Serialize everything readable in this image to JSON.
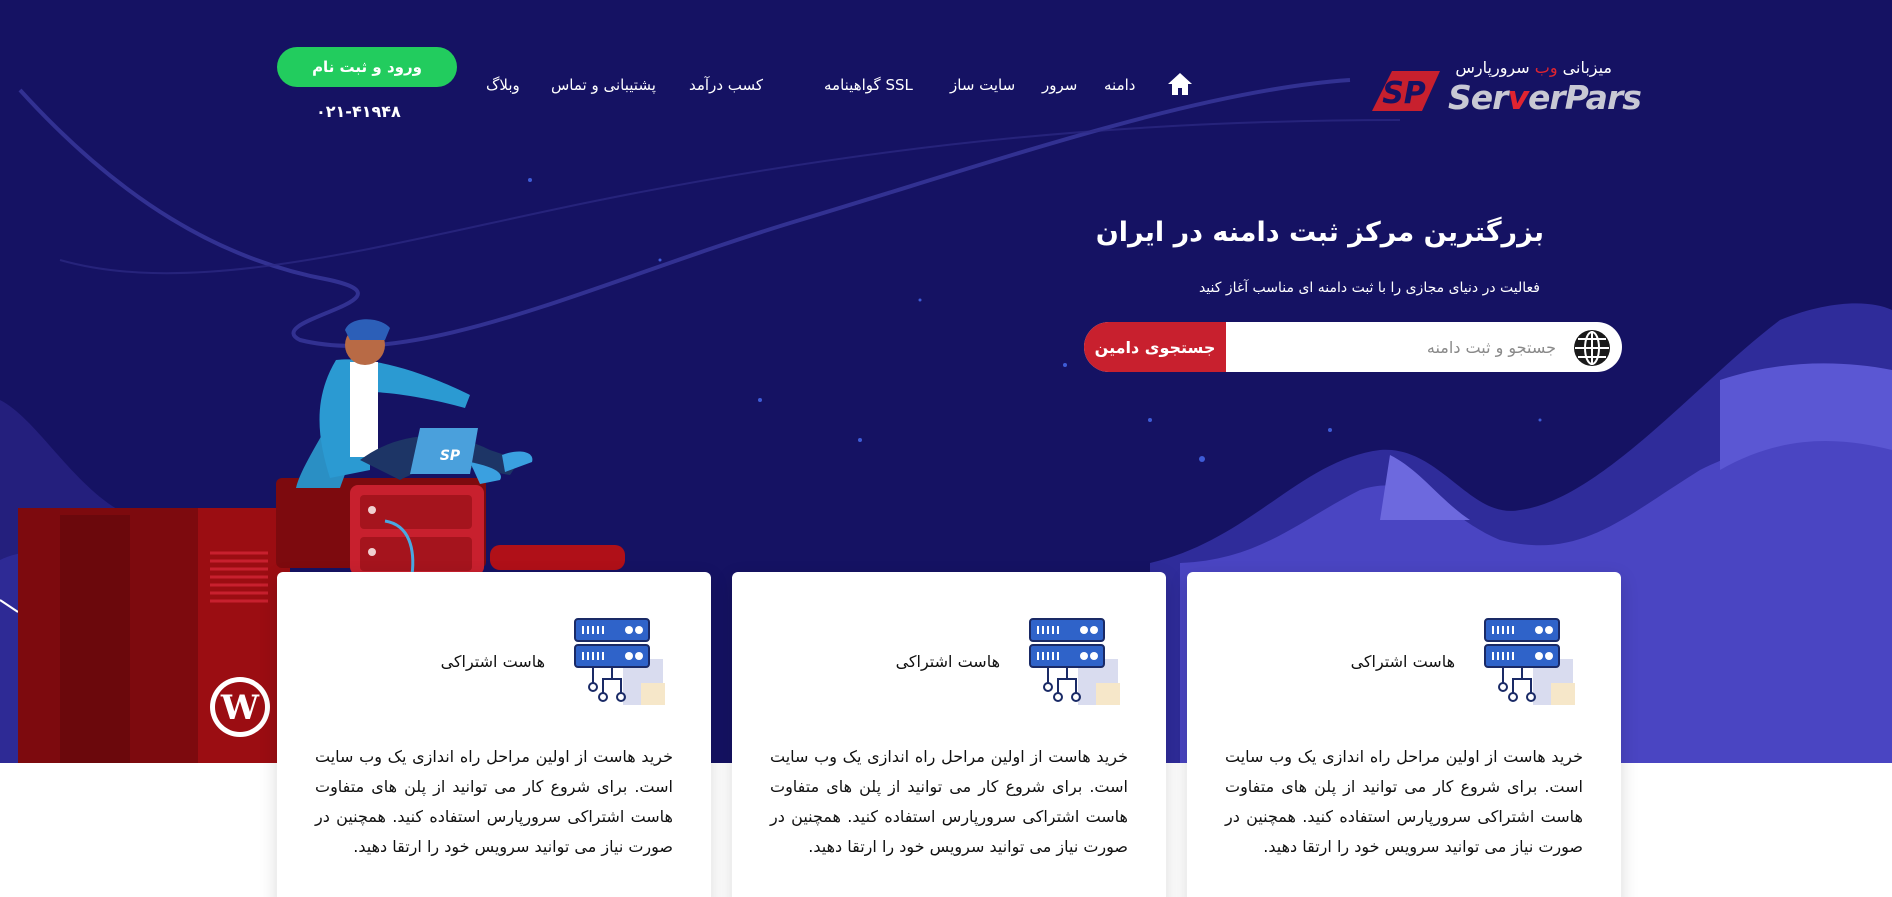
{
  "brand": {
    "tagline_prefix": "میزبانی",
    "tagline_accent": "وب",
    "tagline_suffix": "سرورپارس",
    "wordmark_start": "Ser",
    "wordmark_accent": "v",
    "wordmark_end": "erPars",
    "mark_text": "SP",
    "accent_color": "#e02430"
  },
  "nav": {
    "home_icon": "home-icon",
    "items": [
      {
        "label": "دامنه"
      },
      {
        "label": "سرور"
      },
      {
        "label": "سایت ساز"
      },
      {
        "label": "گواهینامه SSL"
      },
      {
        "label": "کسب درآمد"
      },
      {
        "label": "پشتیبانی و تماس"
      },
      {
        "label": "وبلاگ"
      }
    ]
  },
  "account": {
    "login_label": "ورود و ثبت نام",
    "phone": "۰۲۱-۴۱۹۴۸",
    "button_color": "#22cc5e"
  },
  "hero": {
    "title": "بزرگترین مرکز ثبت دامنه در ایران",
    "subtitle": "فعالیت در دنیای مجازی را با ثبت دامنه ای مناسب آغاز کنید",
    "background_color": "#151263",
    "illustration_laptop_text": "SP"
  },
  "search": {
    "placeholder": "جستجو و ثبت دامنه",
    "button_label": "جستجوی دامین",
    "icon": "globe-icon",
    "button_color": "#c8202e"
  },
  "cards": [
    {
      "title": "هاست اشتراکی",
      "icon": "server-icon",
      "description": "خرید هاست از اولین مراحل راه اندازی یک وب سایت است. برای شروع کار می توانید از پلن های متفاوت هاست اشتراکی سرورپارس استفاده کنید. همچنین در صورت نیاز می توانید سرویس خود را ارتقا دهید."
    },
    {
      "title": "هاست اشتراکی",
      "icon": "server-icon",
      "description": "خرید هاست از اولین مراحل راه اندازی یک وب سایت است. برای شروع کار می توانید از پلن های متفاوت هاست اشتراکی سرورپارس استفاده کنید. همچنین در صورت نیاز می توانید سرویس خود را ارتقا دهید."
    },
    {
      "title": "هاست اشتراکی",
      "icon": "server-icon",
      "description": "خرید هاست از اولین مراحل راه اندازی یک وب سایت است. برای شروع کار می توانید از پلن های متفاوت هاست اشتراکی سرورپارس استفاده کنید. همچنین در صورت نیاز می توانید سرویس خود را ارتقا دهید."
    }
  ]
}
